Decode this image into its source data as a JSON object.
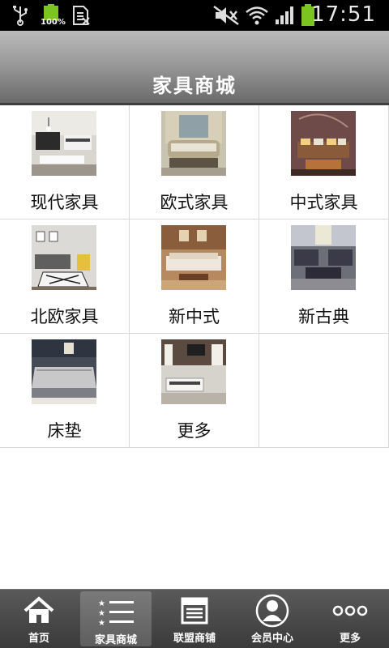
{
  "status_bar": {
    "time": "17:51",
    "battery_text": "100%",
    "icons": [
      "usb-icon",
      "battery-full-icon",
      "sim-icon",
      "mute-icon",
      "wifi-icon",
      "signal-icon",
      "battery-icon"
    ]
  },
  "header": {
    "title": "家具商城"
  },
  "categories": [
    {
      "label": "现代家具",
      "image": "modern-furniture-thumb"
    },
    {
      "label": "欧式家具",
      "image": "european-furniture-thumb"
    },
    {
      "label": "中式家具",
      "image": "chinese-furniture-thumb"
    },
    {
      "label": "北欧家具",
      "image": "nordic-furniture-thumb"
    },
    {
      "label": "新中式",
      "image": "new-chinese-thumb"
    },
    {
      "label": "新古典",
      "image": "neoclassical-thumb"
    },
    {
      "label": "床垫",
      "image": "mattress-thumb"
    },
    {
      "label": "更多",
      "image": "more-thumb"
    }
  ],
  "bottom_nav": [
    {
      "label": "首页",
      "icon": "home-icon"
    },
    {
      "label": "家具商城",
      "icon": "list-icon",
      "active": true
    },
    {
      "label": "联盟商铺",
      "icon": "shop-icon"
    },
    {
      "label": "会员中心",
      "icon": "user-icon"
    },
    {
      "label": "更多",
      "icon": "more-dots-icon"
    }
  ],
  "colors": {
    "header_gradient_top": "#b9b9b9",
    "header_gradient_bottom": "#6a6a6a",
    "nav_background": "#3a3a3a",
    "battery_green": "#7cc520"
  }
}
